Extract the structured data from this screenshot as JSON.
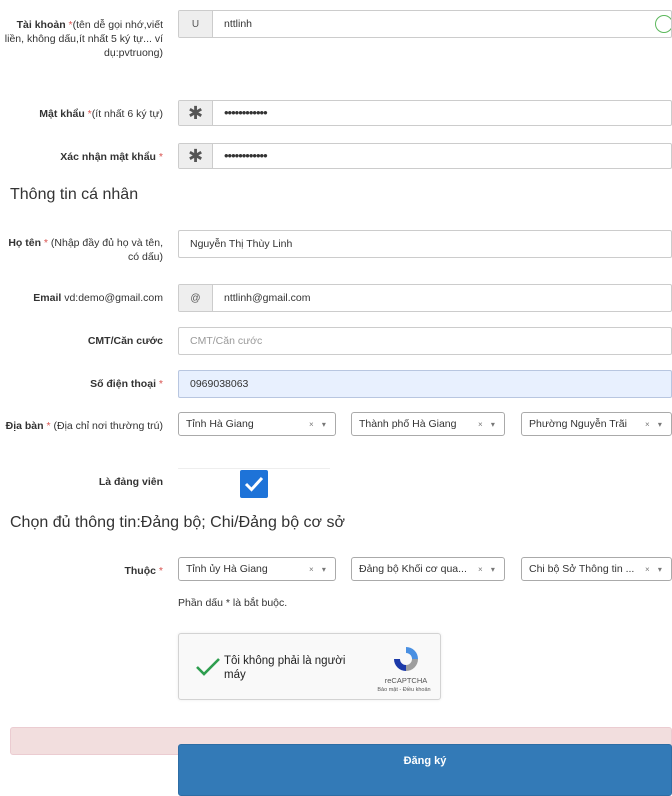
{
  "account": {
    "label": "Tài khoản",
    "required_mark": " *",
    "hint": "(tên dễ gọi nhớ,viết liền, không dấu,ít nhất 5 ký tự... ví dụ:pvtruong)",
    "addon": "U",
    "value": "nttlinh"
  },
  "password": {
    "label": "Mật khẩu",
    "required_mark": " *",
    "hint": "(ít nhất 6 ký tự)",
    "addon": "✱",
    "value": "••••••••••••"
  },
  "confirm_password": {
    "label": "Xác nhận mật khẩu",
    "required_mark": " *",
    "addon": "✱",
    "value": "••••••••••••"
  },
  "personal_section_title": "Thông tin cá nhân",
  "fullname": {
    "label": "Họ tên",
    "required_mark": " *",
    "hint": " (Nhập đầy đủ họ và tên, có dấu)",
    "value": "Nguyễn Thị Thùy Linh"
  },
  "email": {
    "label": "Email",
    "hint": " vd:demo@gmail.com",
    "addon": "@",
    "value": "nttlinh@gmail.com"
  },
  "id_card": {
    "label": "CMT/Căn cước",
    "placeholder": "CMT/Căn cước"
  },
  "phone": {
    "label": "Số điện thoại",
    "required_mark": " *",
    "value": "0969038063"
  },
  "area": {
    "label": "Địa bàn",
    "required_mark": " *",
    "hint": " (Địa chỉ nơi thường trú)",
    "province": "Tỉnh Hà Giang",
    "city": "Thành phố Hà Giang",
    "ward": "Phường Nguyễn Trãi"
  },
  "party_member": {
    "label": "Là đảng viên",
    "checked": true
  },
  "party_section_title": "Chọn đủ thông tin:Đảng bộ; Chi/Đảng bộ cơ sở",
  "belongs_to": {
    "label": "Thuộc",
    "required_mark": " *",
    "committee": "Tỉnh ủy Hà Giang",
    "party_org": "Đảng bộ Khối cơ qua...",
    "branch": "Chi bộ Sở Thông tin ..."
  },
  "required_note": "Phần dấu * là bắt buộc.",
  "recaptcha": {
    "label": "Tôi không phải là người máy",
    "brand": "reCAPTCHA",
    "links": "Bảo mật - Điều khoản"
  },
  "select_controls": "× ▾",
  "submit_label": "Đăng ký",
  "colors": {
    "primary": "#337ab7",
    "checkbox": "#1e73d8",
    "required": "#d9534f",
    "alert_bg": "#f2dede",
    "focus_bg": "#e8f0fe",
    "valid": "#5cb85c"
  }
}
